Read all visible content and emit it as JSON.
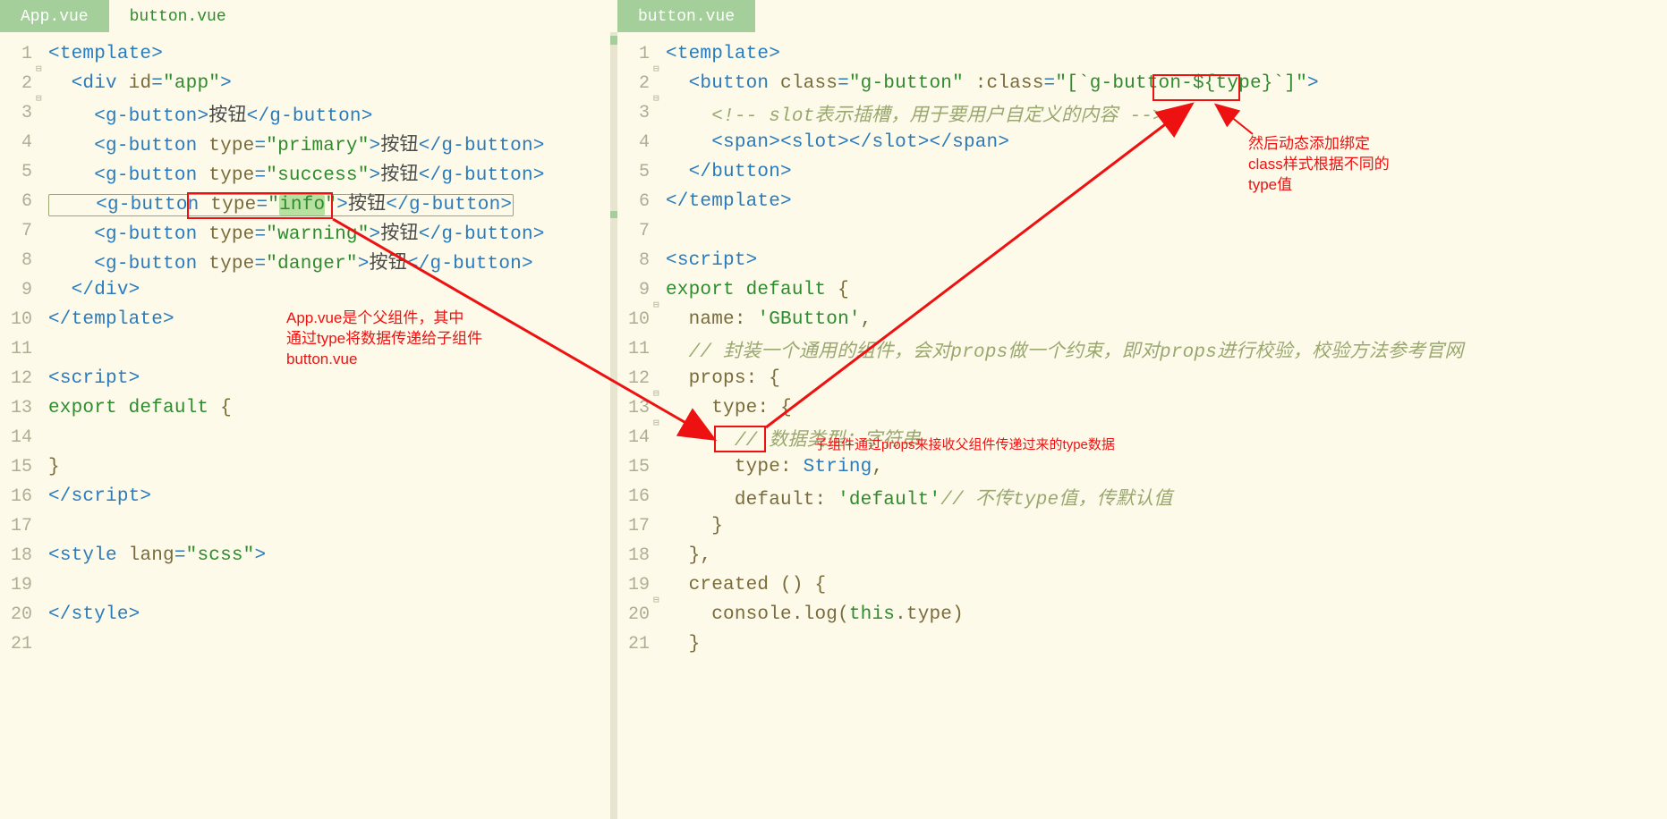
{
  "left": {
    "tabs": [
      {
        "label": "App.vue",
        "active": true
      },
      {
        "label": "button.vue",
        "active": false
      }
    ],
    "lines": [
      {
        "n": 1,
        "fold": true,
        "tokens": [
          [
            "tagp",
            "<"
          ],
          [
            "tagn",
            "template"
          ],
          [
            "tagp",
            ">"
          ]
        ]
      },
      {
        "n": 2,
        "fold": true,
        "tokens": [
          [
            "txt",
            "  "
          ],
          [
            "tagp",
            "<"
          ],
          [
            "tagn",
            "div"
          ],
          [
            "txt",
            " "
          ],
          [
            "attr",
            "id"
          ],
          [
            "tagp",
            "="
          ],
          [
            "str",
            "\"app\""
          ],
          [
            "tagp",
            ">"
          ]
        ]
      },
      {
        "n": 3,
        "fold": false,
        "tokens": [
          [
            "txt",
            "    "
          ],
          [
            "tagp",
            "<"
          ],
          [
            "tagn",
            "g-button"
          ],
          [
            "tagp",
            ">"
          ],
          [
            "txt",
            "按钮"
          ],
          [
            "tagp",
            "</"
          ],
          [
            "tagn",
            "g-button"
          ],
          [
            "tagp",
            ">"
          ]
        ]
      },
      {
        "n": 4,
        "fold": false,
        "tokens": [
          [
            "txt",
            "    "
          ],
          [
            "tagp",
            "<"
          ],
          [
            "tagn",
            "g-button"
          ],
          [
            "txt",
            " "
          ],
          [
            "attr",
            "type"
          ],
          [
            "tagp",
            "="
          ],
          [
            "str",
            "\"primary\""
          ],
          [
            "tagp",
            ">"
          ],
          [
            "txt",
            "按钮"
          ],
          [
            "tagp",
            "</"
          ],
          [
            "tagn",
            "g-button"
          ],
          [
            "tagp",
            ">"
          ]
        ]
      },
      {
        "n": 5,
        "fold": false,
        "tokens": [
          [
            "txt",
            "    "
          ],
          [
            "tagp",
            "<"
          ],
          [
            "tagn",
            "g-button"
          ],
          [
            "txt",
            " "
          ],
          [
            "attr",
            "type"
          ],
          [
            "tagp",
            "="
          ],
          [
            "str",
            "\"success\""
          ],
          [
            "tagp",
            ">"
          ],
          [
            "txt",
            "按钮"
          ],
          [
            "tagp",
            "</"
          ],
          [
            "tagn",
            "g-button"
          ],
          [
            "tagp",
            ">"
          ]
        ]
      },
      {
        "n": 6,
        "fold": false,
        "sel": true,
        "tokens": [
          [
            "txt",
            "    "
          ],
          [
            "tagp",
            "<"
          ],
          [
            "tagn",
            "g-button"
          ],
          [
            "txt",
            " "
          ],
          [
            "attr",
            "type"
          ],
          [
            "tagp",
            "="
          ],
          [
            "str",
            "\""
          ],
          [
            "hl",
            "info"
          ],
          [
            "str",
            "\""
          ],
          [
            "tagp",
            ">"
          ],
          [
            "txt",
            "按钮"
          ],
          [
            "tagp",
            "</"
          ],
          [
            "tagn",
            "g-button"
          ],
          [
            "tagp",
            ">"
          ]
        ]
      },
      {
        "n": 7,
        "fold": false,
        "tokens": [
          [
            "txt",
            "    "
          ],
          [
            "tagp",
            "<"
          ],
          [
            "tagn",
            "g-button"
          ],
          [
            "txt",
            " "
          ],
          [
            "attr",
            "type"
          ],
          [
            "tagp",
            "="
          ],
          [
            "str",
            "\"warning\""
          ],
          [
            "tagp",
            ">"
          ],
          [
            "txt",
            "按钮"
          ],
          [
            "tagp",
            "</"
          ],
          [
            "tagn",
            "g-button"
          ],
          [
            "tagp",
            ">"
          ]
        ]
      },
      {
        "n": 8,
        "fold": false,
        "tokens": [
          [
            "txt",
            "    "
          ],
          [
            "tagp",
            "<"
          ],
          [
            "tagn",
            "g-button"
          ],
          [
            "txt",
            " "
          ],
          [
            "attr",
            "type"
          ],
          [
            "tagp",
            "="
          ],
          [
            "str",
            "\"danger\""
          ],
          [
            "tagp",
            ">"
          ],
          [
            "txt",
            "按钮"
          ],
          [
            "tagp",
            "</"
          ],
          [
            "tagn",
            "g-button"
          ],
          [
            "tagp",
            ">"
          ]
        ]
      },
      {
        "n": 9,
        "fold": false,
        "tokens": [
          [
            "txt",
            "  "
          ],
          [
            "tagp",
            "</"
          ],
          [
            "tagn",
            "div"
          ],
          [
            "tagp",
            ">"
          ]
        ]
      },
      {
        "n": 10,
        "fold": false,
        "tokens": [
          [
            "tagp",
            "</"
          ],
          [
            "tagn",
            "template"
          ],
          [
            "tagp",
            ">"
          ]
        ]
      },
      {
        "n": 11,
        "fold": false,
        "tokens": []
      },
      {
        "n": 12,
        "fold": false,
        "tokens": [
          [
            "tagp",
            "<"
          ],
          [
            "tagn",
            "script"
          ],
          [
            "tagp",
            ">"
          ]
        ]
      },
      {
        "n": 13,
        "fold": false,
        "tokens": [
          [
            "kw",
            "export"
          ],
          [
            "txt",
            " "
          ],
          [
            "kw",
            "default"
          ],
          [
            "txt",
            " "
          ],
          [
            "punct",
            "{"
          ]
        ]
      },
      {
        "n": 14,
        "fold": false,
        "tokens": []
      },
      {
        "n": 15,
        "fold": false,
        "tokens": [
          [
            "punct",
            "}"
          ]
        ]
      },
      {
        "n": 16,
        "fold": false,
        "tokens": [
          [
            "tagp",
            "</"
          ],
          [
            "tagn",
            "script"
          ],
          [
            "tagp",
            ">"
          ]
        ]
      },
      {
        "n": 17,
        "fold": false,
        "tokens": []
      },
      {
        "n": 18,
        "fold": false,
        "tokens": [
          [
            "tagp",
            "<"
          ],
          [
            "tagn",
            "style"
          ],
          [
            "txt",
            " "
          ],
          [
            "attr",
            "lang"
          ],
          [
            "tagp",
            "="
          ],
          [
            "str",
            "\"scss\""
          ],
          [
            "tagp",
            ">"
          ]
        ]
      },
      {
        "n": 19,
        "fold": false,
        "tokens": []
      },
      {
        "n": 20,
        "fold": false,
        "tokens": [
          [
            "tagp",
            "</"
          ],
          [
            "tagn",
            "style"
          ],
          [
            "tagp",
            ">"
          ]
        ]
      },
      {
        "n": 21,
        "fold": false,
        "tokens": []
      }
    ]
  },
  "right": {
    "tabs": [
      {
        "label": "button.vue",
        "active": true
      }
    ],
    "lines": [
      {
        "n": 1,
        "fold": true,
        "tokens": [
          [
            "tagp",
            "<"
          ],
          [
            "tagn",
            "template"
          ],
          [
            "tagp",
            ">"
          ]
        ]
      },
      {
        "n": 2,
        "fold": true,
        "tokens": [
          [
            "txt",
            "  "
          ],
          [
            "tagp",
            "<"
          ],
          [
            "tagn",
            "button"
          ],
          [
            "txt",
            " "
          ],
          [
            "attr",
            "class"
          ],
          [
            "tagp",
            "="
          ],
          [
            "str",
            "\"g-button\""
          ],
          [
            "txt",
            " "
          ],
          [
            "attr",
            ":class"
          ],
          [
            "tagp",
            "="
          ],
          [
            "str",
            "\"[`g-button-"
          ],
          [
            "strE",
            "${type}"
          ],
          [
            "str",
            "`]\""
          ],
          [
            "tagp",
            ">"
          ]
        ]
      },
      {
        "n": 3,
        "fold": false,
        "tokens": [
          [
            "txt",
            "    "
          ],
          [
            "cmt",
            "<!-- slot表示插槽，用于要用户自定义的内容 -->"
          ]
        ]
      },
      {
        "n": 4,
        "fold": false,
        "tokens": [
          [
            "txt",
            "    "
          ],
          [
            "tagp",
            "<"
          ],
          [
            "tagn",
            "span"
          ],
          [
            "tagp",
            ">"
          ],
          [
            "tagp",
            "<"
          ],
          [
            "tagn",
            "slot"
          ],
          [
            "tagp",
            ">"
          ],
          [
            "tagp",
            "</"
          ],
          [
            "tagn",
            "slot"
          ],
          [
            "tagp",
            ">"
          ],
          [
            "tagp",
            "</"
          ],
          [
            "tagn",
            "span"
          ],
          [
            "tagp",
            ">"
          ]
        ]
      },
      {
        "n": 5,
        "fold": false,
        "tokens": [
          [
            "txt",
            "  "
          ],
          [
            "tagp",
            "</"
          ],
          [
            "tagn",
            "button"
          ],
          [
            "tagp",
            ">"
          ]
        ]
      },
      {
        "n": 6,
        "fold": false,
        "tokens": [
          [
            "tagp",
            "</"
          ],
          [
            "tagn",
            "template"
          ],
          [
            "tagp",
            ">"
          ]
        ]
      },
      {
        "n": 7,
        "fold": false,
        "tokens": []
      },
      {
        "n": 8,
        "fold": false,
        "tokens": [
          [
            "tagp",
            "<"
          ],
          [
            "tagn",
            "script"
          ],
          [
            "tagp",
            ">"
          ]
        ]
      },
      {
        "n": 9,
        "fold": true,
        "tokens": [
          [
            "kw",
            "export"
          ],
          [
            "txt",
            " "
          ],
          [
            "kw",
            "default"
          ],
          [
            "txt",
            " "
          ],
          [
            "punct",
            "{"
          ]
        ]
      },
      {
        "n": 10,
        "fold": false,
        "tokens": [
          [
            "txt",
            "  "
          ],
          [
            "fn",
            "name"
          ],
          [
            "punct",
            ":"
          ],
          [
            "txt",
            " "
          ],
          [
            "str",
            "'GButton'"
          ],
          [
            "punct",
            ","
          ]
        ]
      },
      {
        "n": 11,
        "fold": false,
        "tokens": [
          [
            "txt",
            "  "
          ],
          [
            "cmt",
            "// 封装一个通用的组件，会对props做一个约束，即对props进行校验，校验方法参考官网"
          ]
        ]
      },
      {
        "n": 12,
        "fold": true,
        "tokens": [
          [
            "txt",
            "  "
          ],
          [
            "fn",
            "props"
          ],
          [
            "punct",
            ":"
          ],
          [
            "txt",
            " "
          ],
          [
            "punct",
            "{"
          ]
        ]
      },
      {
        "n": 13,
        "fold": true,
        "tokens": [
          [
            "txt",
            "    "
          ],
          [
            "fnK",
            "type"
          ],
          [
            "punct",
            ":"
          ],
          [
            "txt",
            " "
          ],
          [
            "punct",
            "{"
          ]
        ]
      },
      {
        "n": 14,
        "fold": false,
        "tokens": [
          [
            "txt",
            "      "
          ],
          [
            "cmt",
            "// 数据类型：字符串"
          ]
        ]
      },
      {
        "n": 15,
        "fold": false,
        "tokens": [
          [
            "txt",
            "      "
          ],
          [
            "fn",
            "type"
          ],
          [
            "punct",
            ":"
          ],
          [
            "txt",
            " "
          ],
          [
            "tagn",
            "String"
          ],
          [
            "punct",
            ","
          ]
        ]
      },
      {
        "n": 16,
        "fold": false,
        "tokens": [
          [
            "txt",
            "      "
          ],
          [
            "fn",
            "default"
          ],
          [
            "punct",
            ":"
          ],
          [
            "txt",
            " "
          ],
          [
            "str",
            "'default'"
          ],
          [
            "cmt",
            "// 不传type值，传默认值"
          ]
        ]
      },
      {
        "n": 17,
        "fold": false,
        "tokens": [
          [
            "txt",
            "    "
          ],
          [
            "punct",
            "}"
          ]
        ]
      },
      {
        "n": 18,
        "fold": false,
        "tokens": [
          [
            "txt",
            "  "
          ],
          [
            "punct",
            "},"
          ]
        ]
      },
      {
        "n": 19,
        "fold": true,
        "tokens": [
          [
            "txt",
            "  "
          ],
          [
            "fn",
            "created"
          ],
          [
            "txt",
            " "
          ],
          [
            "punct",
            "()"
          ],
          [
            "txt",
            " "
          ],
          [
            "punct",
            "{"
          ]
        ]
      },
      {
        "n": 20,
        "fold": false,
        "tokens": [
          [
            "txt",
            "    "
          ],
          [
            "fn",
            "console"
          ],
          [
            "punct",
            "."
          ],
          [
            "fn",
            "log"
          ],
          [
            "punct",
            "("
          ],
          [
            "kw",
            "this"
          ],
          [
            "punct",
            "."
          ],
          [
            "fn",
            "type"
          ],
          [
            "punct",
            ")"
          ]
        ]
      },
      {
        "n": 21,
        "fold": false,
        "tokens": [
          [
            "txt",
            "  "
          ],
          [
            "punct",
            "}"
          ]
        ]
      }
    ]
  },
  "annotations": {
    "note1": "App.vue是个父组件，其中\n通过type将数据传递给子组件\nbutton.vue",
    "note2": "子组件通过props来接收父组件传递过来的type数据",
    "note3": "然后动态添加绑定\nclass样式根据不同的\ntype值"
  }
}
